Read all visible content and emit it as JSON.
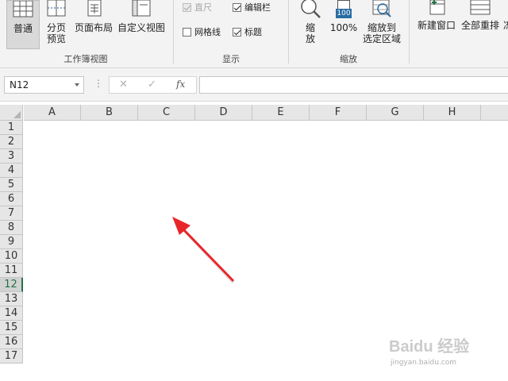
{
  "ribbon": {
    "workbook_views": {
      "label": "工作簿视图",
      "normal": "普通",
      "page_break_line1": "分页",
      "page_break_line2": "预览",
      "page_layout": "页面布局",
      "custom_views": "自定义视图"
    },
    "show": {
      "label": "显示",
      "ruler": "直尺",
      "formula_bar": "编辑栏",
      "gridlines": "网格线",
      "headings": "标题",
      "ruler_checked": true,
      "formula_bar_checked": true,
      "gridlines_checked": false,
      "headings_checked": true
    },
    "zoom": {
      "label": "缩放",
      "zoom_line1": "缩",
      "zoom_line2": "放",
      "zoom_100_icon_text": "100",
      "zoom_100": "100%",
      "zoom_selection_line1": "缩放到",
      "zoom_selection_line2": "选定区域"
    },
    "window": {
      "new_window": "新建窗口",
      "arrange_all": "全部重排",
      "truncated": "冻"
    }
  },
  "formula_bar": {
    "name_box": "N12",
    "dots": "⋮",
    "cancel": "✕",
    "enter": "✓",
    "fx": "fx",
    "value": ""
  },
  "grid": {
    "columns": [
      "A",
      "B",
      "C",
      "D",
      "E",
      "F",
      "G",
      "H"
    ],
    "rows": [
      "1",
      "2",
      "3",
      "4",
      "5",
      "6",
      "7",
      "8",
      "9",
      "10",
      "11",
      "12",
      "13",
      "14",
      "15",
      "16",
      "17"
    ],
    "active_row": "12"
  },
  "annotation": {
    "arrow_color": "#e8262a"
  },
  "watermark": {
    "main": "Baidu 经验",
    "sub": "jingyan.baidu.com"
  },
  "colors": {
    "accent_green": "#217346",
    "ribbon_bg": "#f3f3f3",
    "header_bg": "#e6e6e6"
  }
}
